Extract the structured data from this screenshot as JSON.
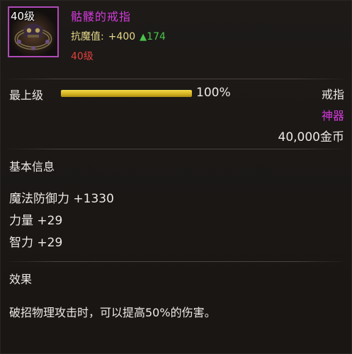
{
  "item": {
    "level_tag": "40级",
    "name": "骷髅的戒指",
    "resist": {
      "label": "抗魔值:",
      "value": "+400",
      "arrow": "▲",
      "delta": "174"
    },
    "required_level": "40级",
    "icon": "skull-ring-icon"
  },
  "quality": {
    "label": "最上级",
    "percent_text": "100%",
    "fill_fraction": 1.0
  },
  "meta": {
    "type": "戒指",
    "rarity": "神器",
    "price": "40,000金币"
  },
  "basic_info": {
    "title": "基本信息",
    "stats": [
      "魔法防御力 +1330",
      "力量 +29",
      "智力 +29"
    ]
  },
  "effect": {
    "title": "效果",
    "text": "破招物理攻击时，可以提高50%的伤害。"
  },
  "colors": {
    "rarity": "#d23ad8",
    "resist_gold": "#e6d98a",
    "increase_green": "#49c44a",
    "level_red": "#e0413c",
    "quality_bar": "#d6b523"
  }
}
